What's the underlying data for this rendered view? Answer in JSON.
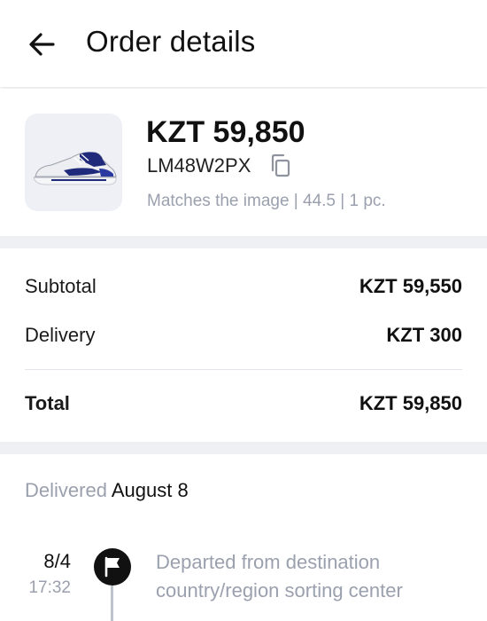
{
  "header": {
    "back_icon": "arrow-left-icon",
    "title": "Order details"
  },
  "product": {
    "image_icon": "sneaker-thumbnail",
    "price": "KZT 59,850",
    "sku": "LM48W2PX",
    "copy_icon": "copy-icon",
    "specs": "Matches the image | 44.5 | 1 pc."
  },
  "summary": {
    "subtotal_label": "Subtotal",
    "subtotal_value": "KZT 59,550",
    "delivery_label": "Delivery",
    "delivery_value": "KZT 300",
    "total_label": "Total",
    "total_value": "KZT 59,850"
  },
  "tracking": {
    "status_word": "Delivered",
    "status_date": "August 8",
    "events": [
      {
        "date": "8/4",
        "time": "17:32",
        "icon": "flag-icon",
        "text": "Departed from destination country/region sorting center"
      }
    ]
  },
  "colors": {
    "text": "#111111",
    "muted": "#9aa0ad",
    "band": "#eef0f4",
    "thumb_bg": "#eef0f5",
    "shoe_accent": "#1f2a7a"
  }
}
